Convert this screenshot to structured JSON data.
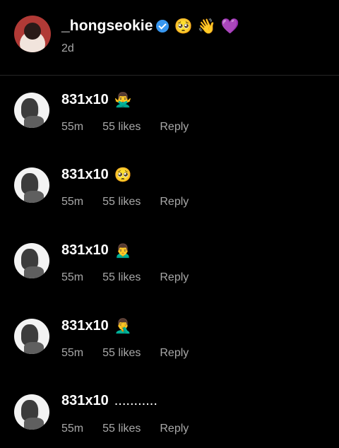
{
  "post": {
    "username": "_hongseokie",
    "emojis": [
      "🥺",
      "👋",
      "💜"
    ],
    "age": "2d"
  },
  "comments": [
    {
      "username": "831x10",
      "text": "🙅‍♂️",
      "time": "55m",
      "likes": "55 likes",
      "reply": "Reply"
    },
    {
      "username": "831x10",
      "text": "🥺",
      "time": "55m",
      "likes": "55 likes",
      "reply": "Reply"
    },
    {
      "username": "831x10",
      "text": "🙍‍♂️",
      "time": "55m",
      "likes": "55 likes",
      "reply": "Reply"
    },
    {
      "username": "831x10",
      "text": "🤦‍♂️",
      "time": "55m",
      "likes": "55 likes",
      "reply": "Reply"
    },
    {
      "username": "831x10",
      "text": "...........",
      "time": "55m",
      "likes": "55 likes",
      "reply": "Reply"
    }
  ],
  "colors": {
    "background": "#000000",
    "primary_text": "#ffffff",
    "secondary_text": "#a8a8a8",
    "verified_badge": "#3897f0",
    "divider": "#262626"
  },
  "icons": {
    "verified": "verified-badge-icon"
  }
}
